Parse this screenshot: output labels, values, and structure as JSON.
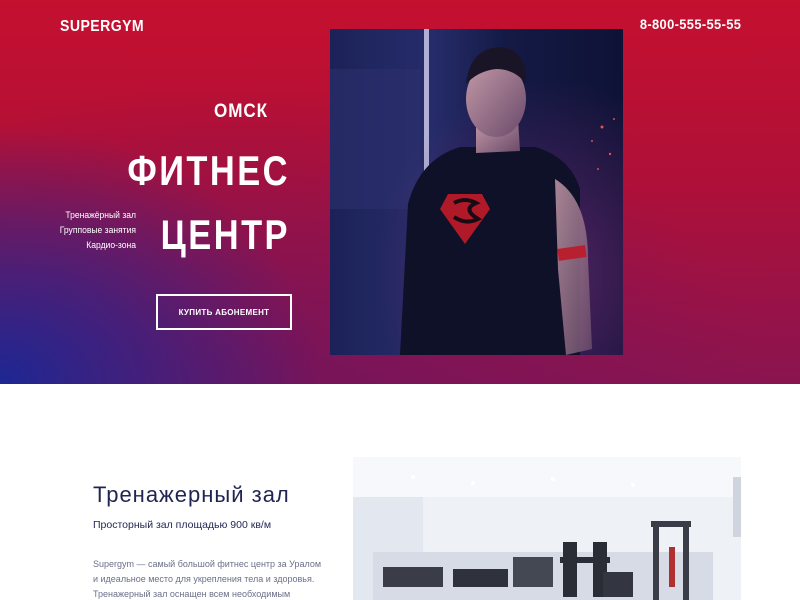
{
  "header": {
    "logo": "SUPERGYM",
    "phone": "8-800-555-55-55"
  },
  "hero": {
    "city": "ОМСК",
    "title_line1": "ФИТНЕС",
    "title_line2": "ЦЕНТР",
    "features": [
      "Тренажёрный зал",
      "Групповые занятия",
      "Кардио-зона"
    ],
    "buy_button": "КУПИТЬ АБОНЕМЕНТ",
    "accent_colors": [
      "#c5102f",
      "#1828a0"
    ]
  },
  "section": {
    "title": "Тренажерный зал",
    "subtitle": "Просторный зал площадью 900 кв/м",
    "text_lines": [
      "Supergym — самый большой фитнес центр за Уралом",
      "и  идеальное место для укрепления тела и здоровья.",
      "Тренажерный зал оснащен всем необходимым"
    ]
  }
}
